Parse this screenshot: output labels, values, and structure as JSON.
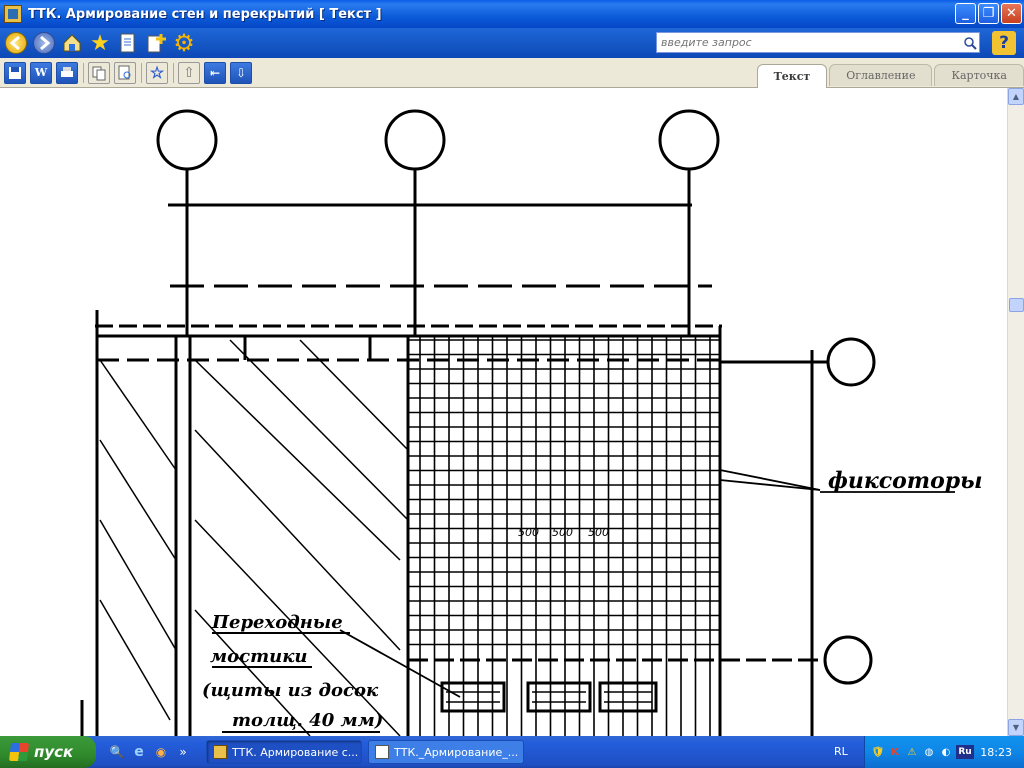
{
  "window": {
    "title": "ТТК. Армирование стен и перекрытий [ Текст ]",
    "buttons": {
      "minimize": "_",
      "maximize": "❐",
      "close": "✕"
    }
  },
  "toolbar": {
    "search_placeholder": "введите запрос",
    "help_label": "?"
  },
  "toolbar2": {
    "icons": [
      "save-icon",
      "word-icon",
      "print-icon",
      "copy-icon",
      "preview-icon",
      "bookmark-icon",
      "up-icon",
      "back-icon",
      "down-icon"
    ]
  },
  "tabs": [
    {
      "label": "Текст",
      "active": true
    },
    {
      "label": "Оглавление",
      "active": false
    },
    {
      "label": "Карточка",
      "active": false
    }
  ],
  "drawing": {
    "label_fixators": "фиксоторы",
    "label_bridges_1": "Переходные",
    "label_bridges_2": "мостики",
    "label_bridges_3": "(щиты из досок",
    "label_bridges_4": "толщ. 40 мм)",
    "dim1": "500",
    "dim2": "500",
    "dim3": "500"
  },
  "taskbar": {
    "start_label": "пуск",
    "tasks": [
      {
        "label": "ТТК. Армирование с...",
        "active": true
      },
      {
        "label": "ТТК._Армирование_...",
        "active": false
      }
    ],
    "lang": "RL",
    "tray_ru": "Ru",
    "clock": "18:23"
  }
}
